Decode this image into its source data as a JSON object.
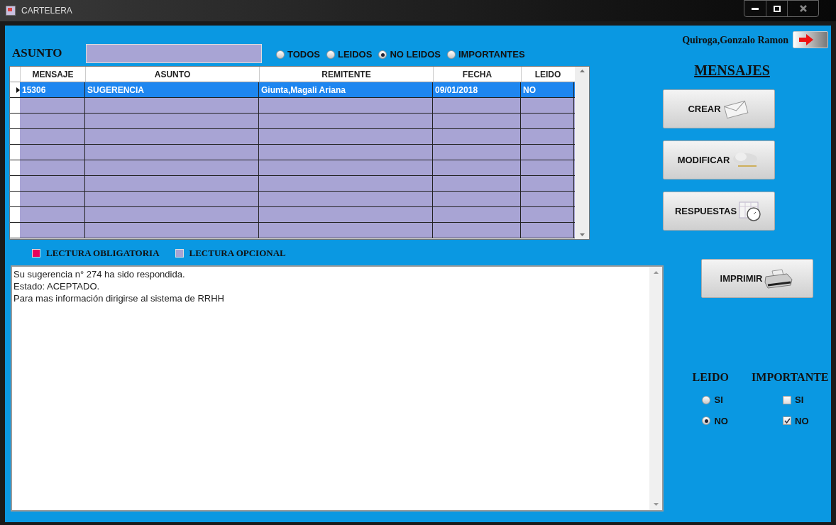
{
  "window": {
    "title": "CARTELERA"
  },
  "filter": {
    "label": "ASUNTO",
    "options": [
      {
        "label": "TODOS",
        "selected": false
      },
      {
        "label": "LEIDOS",
        "selected": false
      },
      {
        "label": "NO LEIDOS",
        "selected": true
      },
      {
        "label": "IMPORTANTES",
        "selected": false
      }
    ]
  },
  "table": {
    "columns": [
      "MENSAJE",
      "ASUNTO",
      "REMITENTE",
      "FECHA",
      "LEIDO"
    ],
    "rows": [
      {
        "cells": [
          "15306",
          "SUGERENCIA",
          "Giunta,Magali Ariana",
          "09/01/2018",
          "NO"
        ],
        "selected": true
      }
    ]
  },
  "legend": [
    {
      "label": "LECTURA OBLIGATORIA",
      "color": "#e8005a"
    },
    {
      "label": "LECTURA OPCIONAL",
      "color": "#a8a4d4"
    }
  ],
  "message": [
    "Su sugerencia n° 274 ha sido respondida.",
    "Estado: ACEPTADO.",
    "Para mas información dirigirse al sistema de RRHH"
  ],
  "user": "Quiroga,Gonzalo Ramon",
  "section_title": "MENSAJES",
  "buttons": [
    {
      "label": "CREAR",
      "kind": "envelope"
    },
    {
      "label": "MODIFICAR",
      "kind": "cloud"
    },
    {
      "label": "RESPUESTAS",
      "kind": "clock"
    },
    {
      "label": "IMPRIMIR",
      "kind": "printer"
    }
  ],
  "leido": {
    "title": "LEIDO",
    "options": [
      {
        "label": "SI",
        "selected": false
      },
      {
        "label": "NO",
        "selected": true
      }
    ]
  },
  "importante": {
    "title": "IMPORTANTE",
    "options": [
      {
        "label": "SI",
        "checked": false
      },
      {
        "label": "NO",
        "checked": true
      }
    ]
  }
}
